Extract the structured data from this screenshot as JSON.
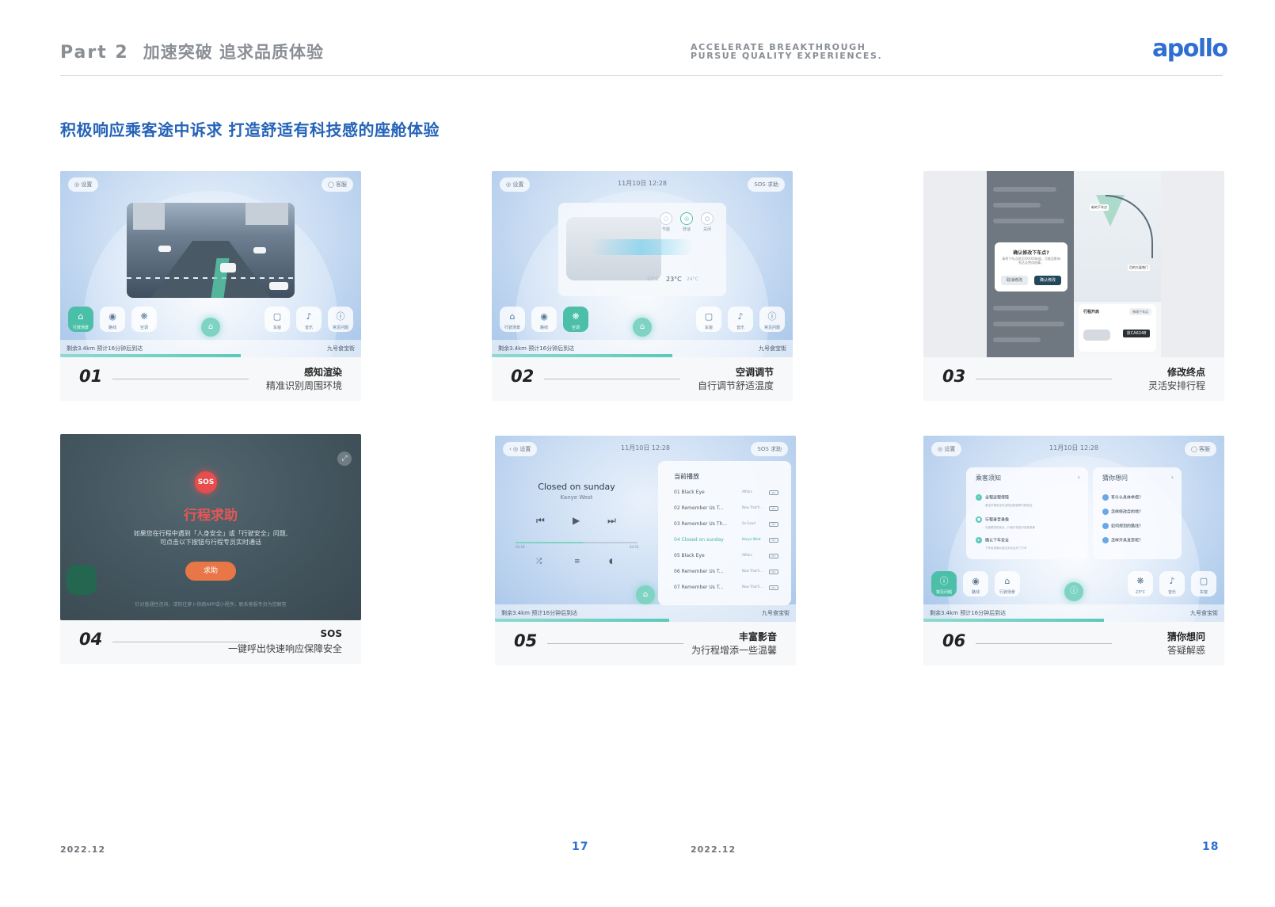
{
  "header": {
    "part_label": "Part 2",
    "part_title": "加速突破 追求品质体验",
    "tagline_line1": "ACCELERATE BREAKTHROUGH",
    "tagline_line2": "PURSUE QUALITY EXPERIENCES.",
    "logo": "apollo"
  },
  "section_title": "积极响应乘客途中诉求 打造舒适有科技感的座舱体验",
  "colors": {
    "accent": "#2563b8",
    "teal": "#4cbfa8",
    "sos_red": "#e84c4c",
    "sos_button": "#e87646"
  },
  "cards": [
    {
      "number": "01",
      "title": "感知渲染",
      "subtitle": "精准识别周围环境",
      "screen": {
        "settings_pill": "◎ 设置",
        "service_pill": "◯ 客服",
        "remaining": "剩余3.4km  预计16分钟后到达",
        "destination": "九号食宝街",
        "progress_fraction": 0.6,
        "buttons_left": [
          {
            "icon": "car-icon",
            "label": "行驶场景",
            "glyph": "⌂"
          },
          {
            "icon": "location-icon",
            "label": "路线",
            "glyph": "◉"
          },
          {
            "icon": "fan-icon",
            "label": "空调",
            "glyph": "❋"
          }
        ],
        "buttons_right": [
          {
            "icon": "window-icon",
            "label": "车窗",
            "glyph": "▢"
          },
          {
            "icon": "music-icon",
            "label": "音乐",
            "glyph": "♪"
          },
          {
            "icon": "info-icon",
            "label": "常见问题",
            "glyph": "ⓘ"
          }
        ]
      }
    },
    {
      "number": "02",
      "title": "空调调节",
      "subtitle": "自行调节舒适温度",
      "screen": {
        "settings_pill": "◎ 设置",
        "sos_pill": "SOS 求助",
        "clock": "11月10日 12:28",
        "modes": [
          {
            "label": "节能",
            "glyph": "◌"
          },
          {
            "label": "舒适",
            "glyph": "◎"
          },
          {
            "label": "关闭",
            "glyph": "○"
          }
        ],
        "temp_current": "23°C",
        "temp_low": "22°C",
        "temp_high": "24°C",
        "remaining": "剩余3.4km  预计16分钟后到达",
        "destination": "九号食宝街",
        "progress_fraction": 0.6,
        "buttons_left": [
          {
            "icon": "car-icon",
            "label": "行驶场景",
            "glyph": "⌂"
          },
          {
            "icon": "location-icon",
            "label": "路线",
            "glyph": "◉"
          },
          {
            "icon": "fan-icon",
            "label": "空调",
            "glyph": "❋"
          }
        ],
        "buttons_right": [
          {
            "icon": "window-icon",
            "label": "车窗",
            "glyph": "▢"
          },
          {
            "icon": "music-icon",
            "label": "音乐",
            "glyph": "♪"
          },
          {
            "icon": "info-icon",
            "label": "常见问题",
            "glyph": "ⓘ"
          }
        ]
      }
    },
    {
      "number": "03",
      "title": "修改终点",
      "subtitle": "灵活安排行程",
      "screen": {
        "dialog_title": "确认修改下车点?",
        "dialog_body": "请将下车点改至XXXXX街道，可能会影响到达及费用结算。",
        "cancel": "取消修改",
        "confirm": "确认修改",
        "map_label_1": "新的下车点",
        "map_label_2": "目的大厦南门",
        "trip_title": "行程开启",
        "trip_button": "修改下车点",
        "plate": "京CA6248"
      }
    },
    {
      "number": "04",
      "title": "SOS",
      "subtitle": "一键呼出快速响应保障安全",
      "screen": {
        "badge": "SOS",
        "heading": "行程求助",
        "body_line1": "如果您在行程中遇到「人身安全」或「行驶安全」问题,",
        "body_line2": "可点击以下按钮与行程专员实时通话",
        "button": "求助",
        "footer": "针对普通性咨询，请前往萝卜快跑APP或小程序，联系客服专员为您解答"
      }
    },
    {
      "number": "05",
      "title": "丰富影音",
      "subtitle": "为行程增添一些温馨",
      "screen": {
        "back_pill": "‹  ◎ 设置",
        "sos_pill": "SOS 求助",
        "clock": "11月10日 12:28",
        "song": "Closed on sunday",
        "artist": "Kanye West",
        "time_elapsed": "02:18",
        "time_total": "04:53",
        "progress_fraction": 0.55,
        "playlist_title": "当前播放",
        "tracks": [
          {
            "label": "01  Black Eye",
            "album": "Affairs",
            "active": false
          },
          {
            "label": "02  Remember Us T...",
            "album": "Now That'll...",
            "active": false
          },
          {
            "label": "03  Remember Us Th...",
            "album": "So Good",
            "active": false
          },
          {
            "label": "04  Closed on sunday",
            "album": "Kanye West",
            "active": true
          },
          {
            "label": "05  Black Eye",
            "album": "Affairs",
            "active": false
          },
          {
            "label": "06  Remember Us T...",
            "album": "Now That'll...",
            "active": false
          },
          {
            "label": "07  Remember Us T...",
            "album": "Now That'll...",
            "active": false
          }
        ],
        "mv_badge": "MV",
        "remaining": "剩余3.4km  预计16分钟后到达",
        "destination": "九号食宝街"
      }
    },
    {
      "number": "06",
      "title": "猜你想问",
      "subtitle": "答疑解惑",
      "screen": {
        "settings_pill": "◎ 设置",
        "service_pill": "◯ 客服",
        "clock": "11月10日 12:28",
        "notice_title": "乘客须知",
        "notice_items": [
          {
            "title": "全程远程保障",
            "desc": "乘坐车辆安全员全程远程保障行程安全"
          },
          {
            "title": "行程录音录像",
            "desc": "为保障您的安全，行程中将进行录音录像"
          },
          {
            "title": "确认下车安全",
            "desc": "下车前请确认周边安全后开门下车"
          }
        ],
        "faq_title": "猜你想问",
        "faq_items": [
          "有什么具体举措?",
          "怎样修改目的地?",
          "如何规划的路线?",
          "怎样开具发票呢?"
        ],
        "remaining": "剩余3.4km  预计16分钟后到达",
        "destination": "九号食宝街",
        "progress_fraction": 0.6,
        "buttons_left": [
          {
            "icon": "info-icon",
            "label": "常见问题",
            "glyph": "ⓘ"
          },
          {
            "icon": "location-icon",
            "label": "路线",
            "glyph": "◉"
          },
          {
            "icon": "car-icon",
            "label": "行驶场景",
            "glyph": "⌂"
          }
        ],
        "buttons_right": [
          {
            "icon": "fan-icon",
            "label": "23°C",
            "glyph": "❋"
          },
          {
            "icon": "music-icon",
            "label": "音乐",
            "glyph": "♪"
          },
          {
            "icon": "window-icon",
            "label": "车窗",
            "glyph": "▢"
          }
        ]
      }
    }
  ],
  "footer": {
    "date_left": "2022.12",
    "page_left": "17",
    "date_right": "2022.12",
    "page_right": "18"
  }
}
